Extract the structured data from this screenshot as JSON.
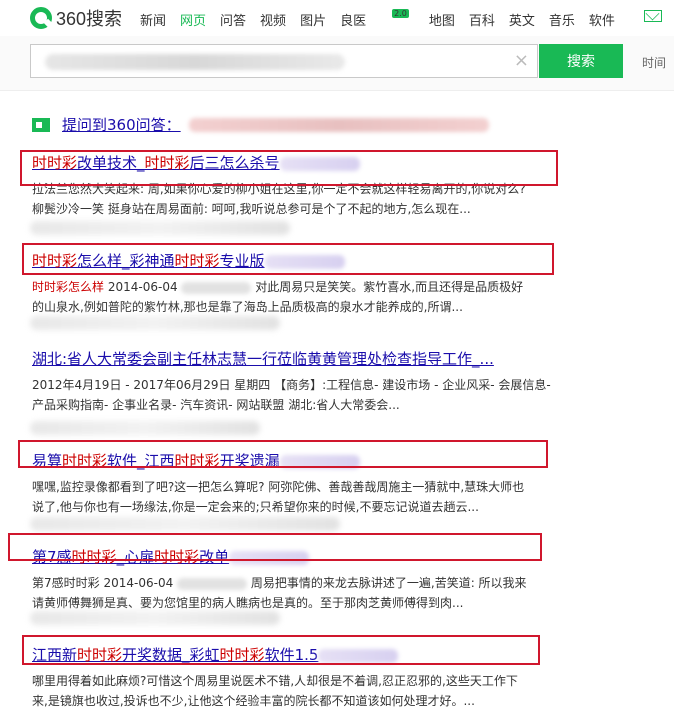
{
  "header": {
    "logo_text": "360搜索",
    "nav": [
      {
        "label": "新闻",
        "active": false
      },
      {
        "label": "网页",
        "active": true
      },
      {
        "label": "问答",
        "active": false
      },
      {
        "label": "视频",
        "active": false
      },
      {
        "label": "图片",
        "active": false
      },
      {
        "label": "良医",
        "active": false,
        "badge": "2.0"
      },
      {
        "label": "地图",
        "active": false
      },
      {
        "label": "百科",
        "active": false
      },
      {
        "label": "英文",
        "active": false
      },
      {
        "label": "音乐",
        "active": false
      },
      {
        "label": "软件",
        "active": false
      }
    ]
  },
  "search": {
    "button_label": "搜索",
    "clear_glyph": "×",
    "time_link": "时间"
  },
  "ask": {
    "link_text": "提问到360问答："
  },
  "results": [
    {
      "title_parts": [
        {
          "t": "时时彩",
          "hl": true
        },
        {
          "t": "改单技术_",
          "hl": false
        },
        {
          "t": "时时彩",
          "hl": true
        },
        {
          "t": "后三怎么杀号",
          "hl": false
        }
      ],
      "snippet": "拉法兰您然大笑起来: 周,如果你心爱的柳小姐在这里,你一定不会就这样轻易离开的,你说对么?",
      "snippet2": "柳鬓沙冷一笑 挺身站在周易面前: 呵呵,我听说总参可是个了不起的地方,怎么现在..."
    },
    {
      "title_parts": [
        {
          "t": "时时彩",
          "hl": true
        },
        {
          "t": "怎么样_彩神通",
          "hl": false
        },
        {
          "t": "时时彩",
          "hl": true
        },
        {
          "t": "专业版",
          "hl": false
        }
      ],
      "snippet_prefix": "时时彩怎么样",
      "snippet_date": "2014-06-04",
      "snippet": "对此周易只是笑笑。紫竹喜水,而且还得是品质极好",
      "snippet2": "的山泉水,例如普陀的紫竹林,那也是靠了海岛上品质极高的泉水才能养成的,所谓..."
    },
    {
      "title_parts": [
        {
          "t": "湖北:省人大常委会副主任林志慧一行莅临黄黄管理处检查指导工作_...",
          "hl": false
        }
      ],
      "snippet": "2012年4月19日 - 2017年06月29日 星期四 【商务】:工程信息- 建设市场 - 企业风采- 会展信息-",
      "snippet2": "产品采购指南- 企事业名录- 汽车资讯- 网站联盟 湖北:省人大常委会..."
    },
    {
      "title_parts": [
        {
          "t": "易算",
          "hl": false
        },
        {
          "t": "时时彩",
          "hl": true
        },
        {
          "t": "软件_江西",
          "hl": false
        },
        {
          "t": "时时彩",
          "hl": true
        },
        {
          "t": "开奖遗漏",
          "hl": false
        }
      ],
      "snippet": "嘿嘿,监控录像都看到了吧?这一把怎么算呢? 阿弥陀佛、善哉善哉周施主一猜就中,慧珠大师也",
      "snippet2": "说了,他与你也有一场缘法,你是一定会来的;只希望你来的时候,不要忘记说道去趟云..."
    },
    {
      "title_parts": [
        {
          "t": "第7感",
          "hl": false
        },
        {
          "t": "时时彩",
          "hl": true
        },
        {
          "t": "_心扉",
          "hl": false
        },
        {
          "t": "时时彩",
          "hl": true
        },
        {
          "t": "改单",
          "hl": false
        }
      ],
      "snippet_prefix": "第7感时时彩",
      "snippet_date": "2014-06-04",
      "snippet": "周易把事情的来龙去脉讲述了一遍,苦笑道: 所以我来",
      "snippet2": "请黄师傅舞狮是真、要为您馆里的病人瞧病也是真的。至于那肉芝黄师傅得到肉..."
    },
    {
      "title_parts": [
        {
          "t": "江西新",
          "hl": false
        },
        {
          "t": "时时彩",
          "hl": true
        },
        {
          "t": "开奖数据_彩虹",
          "hl": false
        },
        {
          "t": "时时彩",
          "hl": true
        },
        {
          "t": "软件1.5",
          "hl": false
        }
      ],
      "snippet": "哪里用得着如此麻烦?可惜这个周易里说医术不错,人却很是不着调,忍正忍邪的,这些天工作下",
      "snippet2": "来,是镜旗也收过,投诉也不少,让他这个经验丰富的院长都不知道该如何处理才好。..."
    }
  ],
  "colors": {
    "brand": "#19b955",
    "link": "#1a0dab",
    "highlight": "#c00",
    "annotation_box": "#d0172d"
  }
}
